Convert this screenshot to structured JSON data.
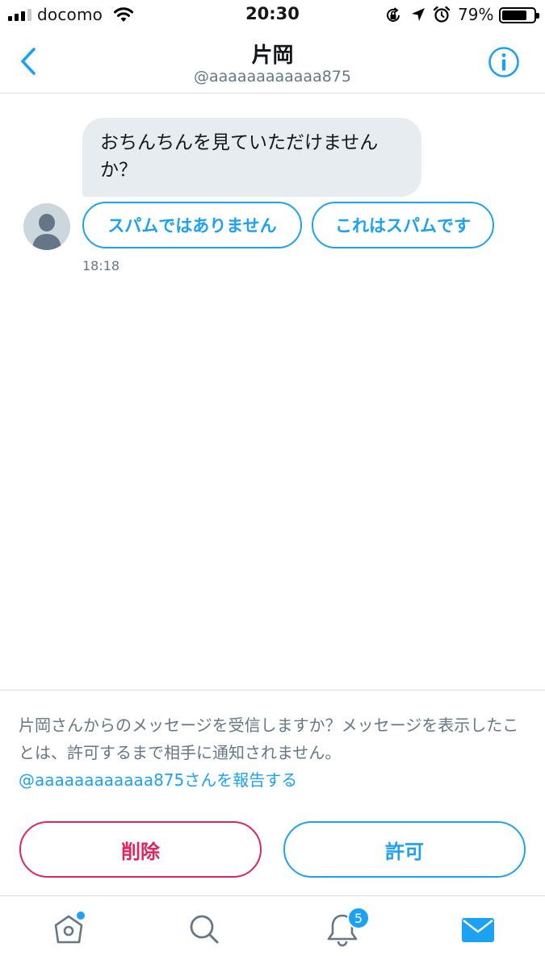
{
  "status_bar": {
    "carrier": "docomo",
    "time": "20:30",
    "battery_percent": "79%",
    "battery_level": 0.79,
    "icons": [
      "signal-icon",
      "wifi-icon",
      "orientation-lock-icon",
      "location-icon",
      "alarm-icon",
      "battery-icon"
    ]
  },
  "header": {
    "title": "片岡",
    "handle": "@aaaaaaaaaaaa875",
    "back_icon": "chevron-left-icon",
    "info_icon": "info-icon"
  },
  "conversation": {
    "message": "おちんちんを見ていただけませんか？",
    "time": "18:18",
    "spam_options": [
      "スパムではありません",
      "これはスパムです"
    ]
  },
  "request_panel": {
    "notice": "片岡さんからのメッセージを受信しますか？メッセージを表示したことは、許可するまで相手に通知されません。",
    "report_link": "@aaaaaaaaaaaa875さんを報告する",
    "delete_label": "削除",
    "allow_label": "許可"
  },
  "tab_bar": {
    "items": [
      "home-icon",
      "search-icon",
      "notifications-icon",
      "messages-icon"
    ],
    "notification_count": "5"
  },
  "colors": {
    "accent": "#1da1f2",
    "danger": "#e0245e",
    "bubble": "#e6ecf0",
    "secondary_text": "#657786"
  }
}
